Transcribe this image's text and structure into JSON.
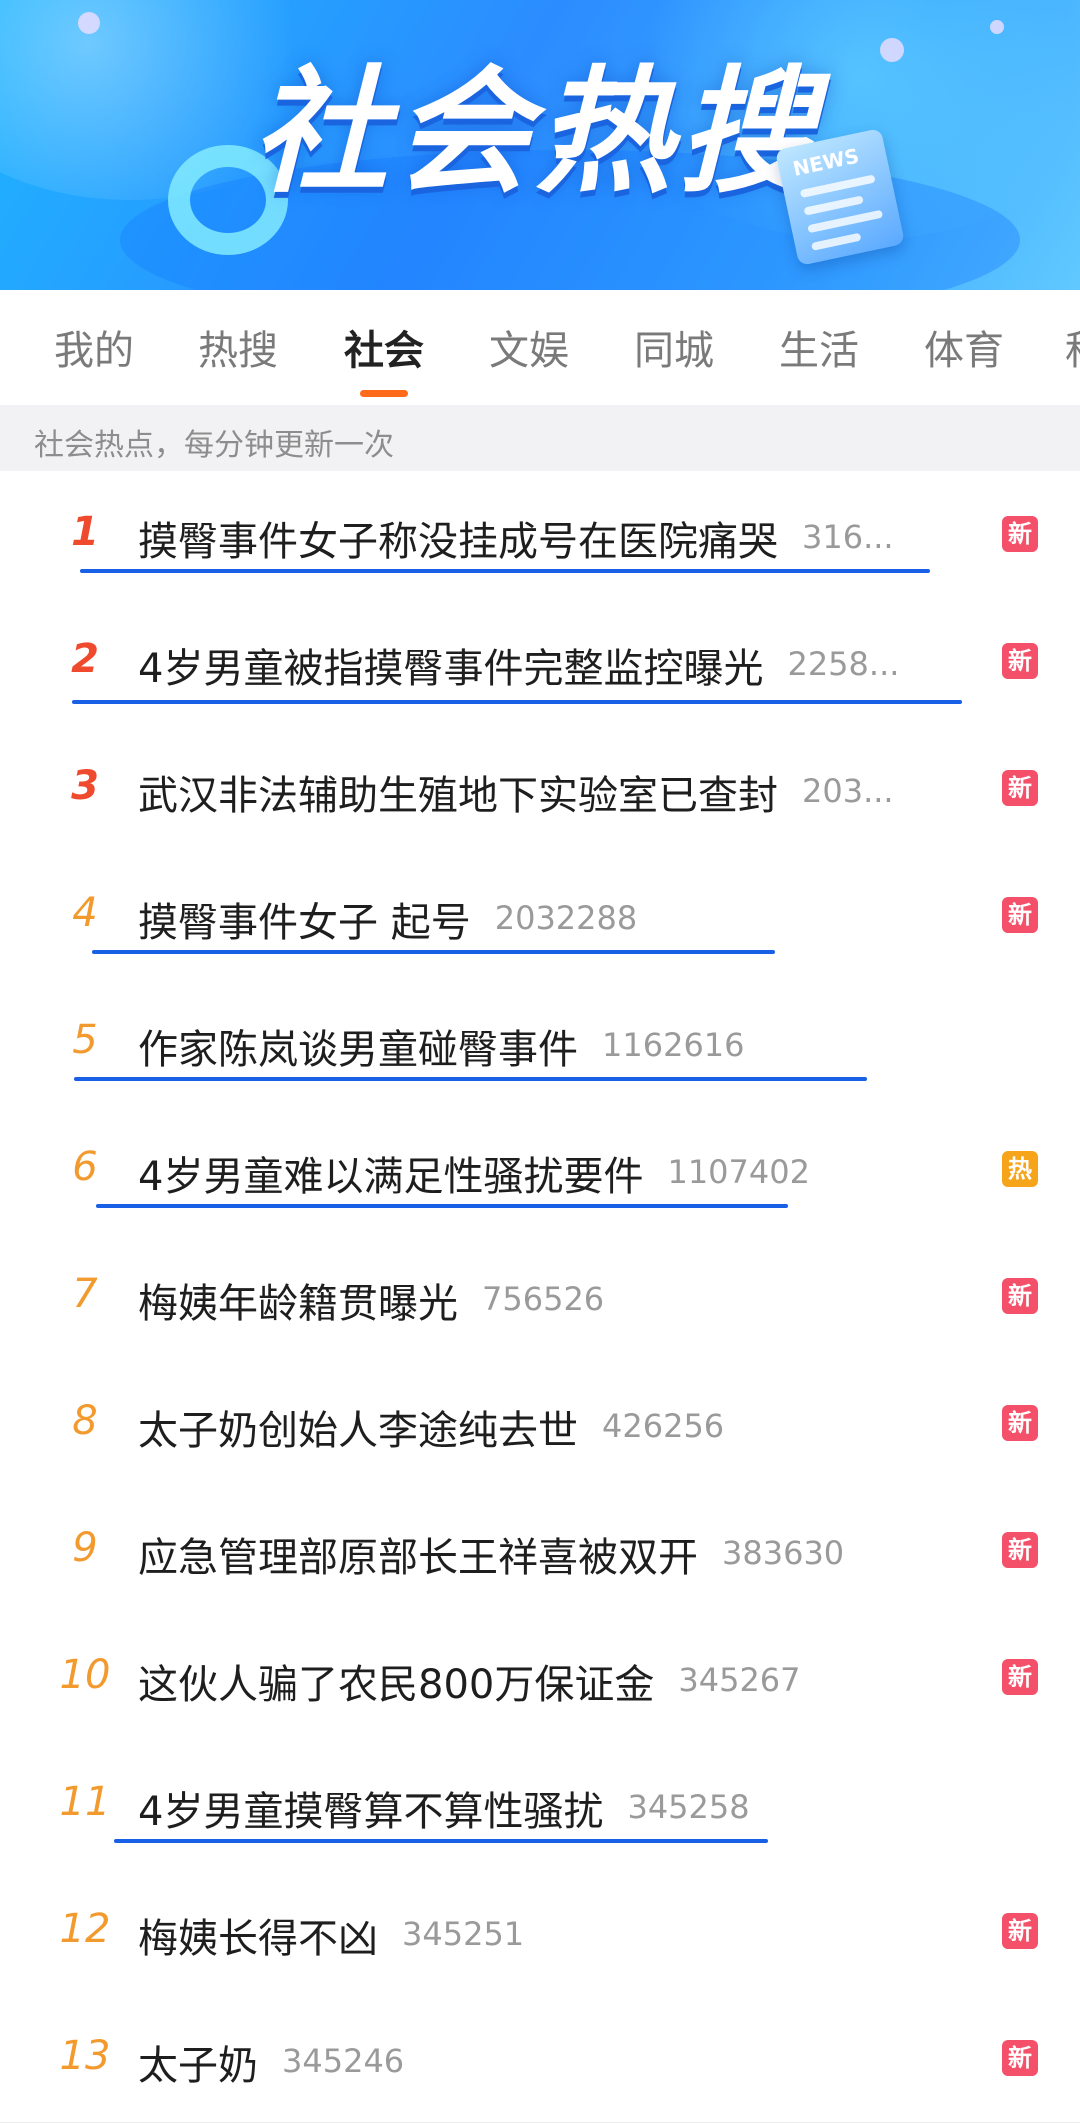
{
  "banner": {
    "title": "社会热搜",
    "news_label": "NEWS"
  },
  "tabs": [
    "我的",
    "热搜",
    "社会",
    "文娱",
    "同城",
    "生活",
    "体育",
    "科"
  ],
  "active_tab": "社会",
  "subtitle": "社会热点，每分钟更新一次",
  "colors": {
    "accent": "#ff6a1a",
    "new_badge": "#f4506a",
    "hot_badge": "#f6a41a",
    "underline": "#1860e6"
  },
  "badge_labels": {
    "new": "新",
    "hot": "热"
  },
  "items": [
    {
      "rank": "1",
      "title": "摸臀事件女子称没挂成号在医院痛哭",
      "count": "316...",
      "badge": "new"
    },
    {
      "rank": "2",
      "title": "4岁男童被指摸臀事件完整监控曝光",
      "count": "2258...",
      "badge": "new"
    },
    {
      "rank": "3",
      "title": "武汉非法辅助生殖地下实验室已查封",
      "count": "203...",
      "badge": "new"
    },
    {
      "rank": "4",
      "title": "摸臀事件女子 起号",
      "count": "2032288",
      "badge": "new"
    },
    {
      "rank": "5",
      "title": "作家陈岚谈男童碰臀事件",
      "count": "1162616",
      "badge": null
    },
    {
      "rank": "6",
      "title": "4岁男童难以满足性骚扰要件",
      "count": "1107402",
      "badge": "hot"
    },
    {
      "rank": "7",
      "title": "梅姨年龄籍贯曝光",
      "count": "756526",
      "badge": "new"
    },
    {
      "rank": "8",
      "title": "太子奶创始人李途纯去世",
      "count": "426256",
      "badge": "new"
    },
    {
      "rank": "9",
      "title": "应急管理部原部长王祥喜被双开",
      "count": "383630",
      "badge": "new"
    },
    {
      "rank": "10",
      "title": "这伙人骗了农民800万保证金",
      "count": "345267",
      "badge": "new"
    },
    {
      "rank": "11",
      "title": "4岁男童摸臀算不算性骚扰",
      "count": "345258",
      "badge": null
    },
    {
      "rank": "12",
      "title": "梅姨长得不凶",
      "count": "345251",
      "badge": "new"
    },
    {
      "rank": "13",
      "title": "太子奶",
      "count": "345246",
      "badge": "new"
    }
  ]
}
